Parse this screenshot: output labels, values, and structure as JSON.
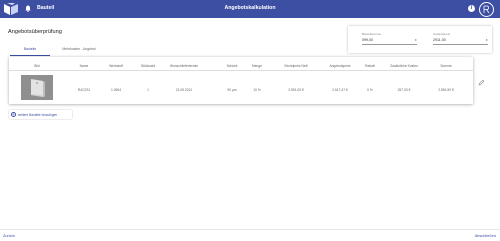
{
  "header": {
    "breadcrumb": "Bauteil",
    "title": "Angebotskalkulation",
    "info_icon": "i",
    "avatar_initials": "R"
  },
  "page": {
    "heading": "Angebotsüberprüfung"
  },
  "totals": {
    "fields": [
      {
        "label": "Bauteilsumme",
        "value": "099,00",
        "unit": "€"
      },
      {
        "label": "Gesamtpreis",
        "value": "2911,00",
        "unit": "€"
      }
    ]
  },
  "tabs": [
    {
      "label": "Bauteile",
      "active": true
    },
    {
      "label": "Mehrkosten - Angebot",
      "active": false
    }
  ],
  "table": {
    "headers": [
      "Bild",
      "Name",
      "Werkstoff",
      "Stückzahl",
      "Wunschliefertermin",
      "Schicht",
      "Menge",
      "Einzelpreis Nett",
      "Angebotspreis",
      "Rabatt",
      "Zusätzliche Kosten",
      "Summe"
    ],
    "rows": [
      [
        "",
        "R4C2S1",
        "1.0964",
        "1",
        "21.05.2021",
        "90 µm",
        "10 %",
        "2.591,00 €",
        "2.617,47 €",
        "0 %",
        "257,00 €",
        "2.894,90 €"
      ]
    ]
  },
  "actions": {
    "add_part": "weitere Bauteile hinzufügen",
    "back": "Zurück",
    "finish": "Abschließen"
  },
  "colors": {
    "primary": "#3d4fa3",
    "topbar_text": "#ffffff"
  },
  "icons": {
    "logo": "logo-icon",
    "bell": "bell-icon",
    "info": "info-icon",
    "avatar": "avatar-icon",
    "edit": "pencil-icon",
    "add": "plus-icon",
    "thumbnail": "part-thumbnail"
  }
}
